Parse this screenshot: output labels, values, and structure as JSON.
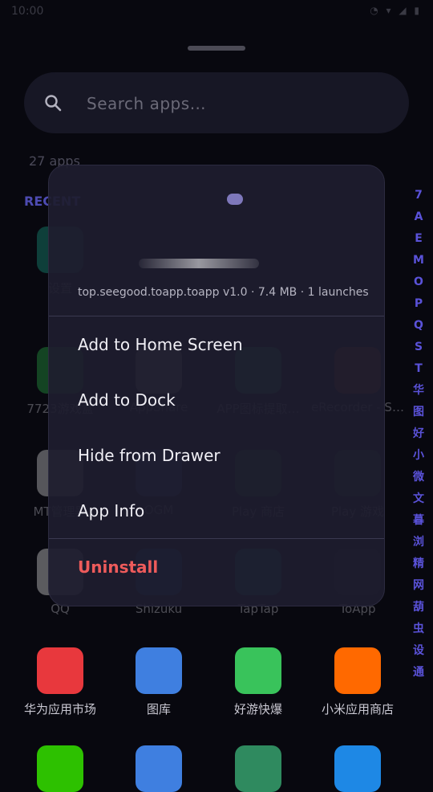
{
  "status_bar": {
    "time": "10:00",
    "icons": "◔ ▾ ◢ ▮"
  },
  "search": {
    "placeholder": "Search apps…",
    "icon": "search-icon"
  },
  "apps_count": "27 apps",
  "recent_label": "RECENT",
  "alphabet": [
    "7",
    "A",
    "E",
    "M",
    "O",
    "P",
    "Q",
    "S",
    "T",
    "华",
    "图",
    "好",
    "小",
    "微",
    "文",
    "暮",
    "浏",
    "精",
    "网",
    "葫",
    "虫",
    "设",
    "通"
  ],
  "recent_apps": [
    {
      "label": "设置",
      "icon": "gear-icon",
      "color": "#1aa58a"
    }
  ],
  "apps": [
    {
      "label": "7723游戏盒",
      "icon": "game-box-icon",
      "color": "#2bb34a"
    },
    {
      "label": "AppShare",
      "icon": "appshare-icon",
      "color": "#d8d8d8"
    },
    {
      "label": "APP图标提取…",
      "icon": "android-extract-icon",
      "color": "#3ddc84"
    },
    {
      "label": "eRecorder - S…",
      "icon": "video-recorder-icon",
      "color": "#f26522"
    },
    {
      "label": "MT管理器",
      "icon": "mt-icon",
      "color": "#e8e8e8"
    },
    {
      "label": "OGM",
      "icon": "ogm-icon",
      "color": "#5b6bd6"
    },
    {
      "label": "Play 商店",
      "icon": "play-store-icon",
      "color": "#34a853"
    },
    {
      "label": "Play 游戏",
      "icon": "play-games-icon",
      "color": "#2e7d32"
    },
    {
      "label": "QQ",
      "icon": "qq-penguin-icon",
      "color": "#f5f5f5"
    },
    {
      "label": "Shizuku",
      "icon": "shizuku-icon",
      "color": "#1976d2"
    },
    {
      "label": "TapTap",
      "icon": "taptap-icon",
      "color": "#14c0c9"
    },
    {
      "label": "ToApp",
      "icon": "toapp-icon",
      "color": "#2a2a44"
    },
    {
      "label": "华为应用市场",
      "icon": "huawei-appgallery-icon",
      "color": "#e8383d"
    },
    {
      "label": "图库",
      "icon": "gallery-icon",
      "color": "#3f7fe0"
    },
    {
      "label": "好游快爆",
      "icon": "haoyou-icon",
      "color": "#39c35b"
    },
    {
      "label": "小米应用商店",
      "icon": "mi-store-icon",
      "color": "#ff6900"
    }
  ],
  "bottom_apps": [
    {
      "icon": "wechat-icon",
      "color": "#2dc100"
    },
    {
      "icon": "files-icon",
      "color": "#3f7fe0"
    },
    {
      "icon": "android-icon",
      "color": "#2f8a5f"
    },
    {
      "icon": "browser-icon",
      "color": "#1e88e5"
    }
  ],
  "context_menu": {
    "package_info": "top.seegood.toapp.toapp v1.0 · 7.4 MB · 1 launches",
    "items": [
      "Add to Home Screen",
      "Add to Dock",
      "Hide from Drawer",
      "App Info"
    ],
    "uninstall": "Uninstall"
  }
}
